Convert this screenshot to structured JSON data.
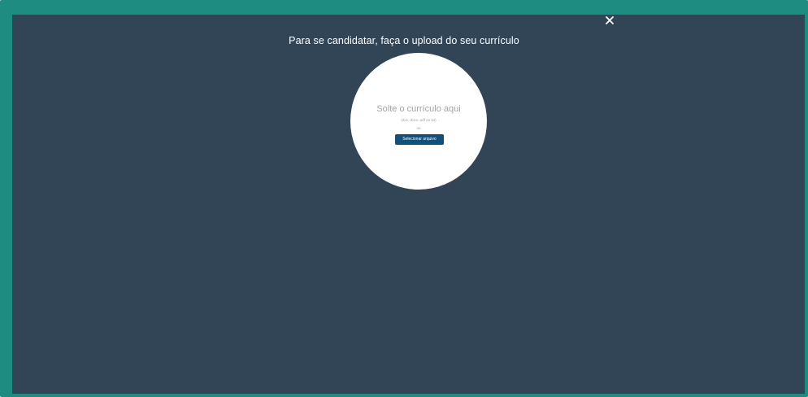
{
  "modal": {
    "title": "Para se candidatar, faça o upload do seu currículo",
    "close_icon": "close-icon"
  },
  "dropzone": {
    "title": "Solte o currículo aqui",
    "formats": "(doc, docx, pdf ou txt)",
    "or_text": "ou",
    "button_label": "Selecionar arquivo"
  },
  "colors": {
    "frame": "#1e8c80",
    "overlay": "#324557",
    "button": "#10507a"
  }
}
